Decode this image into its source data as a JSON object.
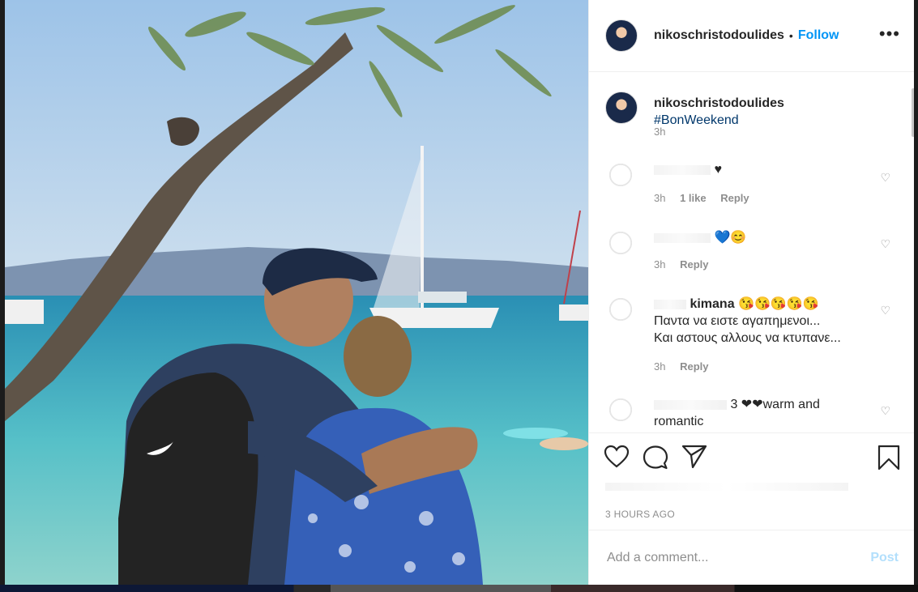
{
  "post": {
    "username": "nikoschristodoulides",
    "dot": "•",
    "follow_label": "Follow",
    "more_label": "•••",
    "caption_tag": "#BonWeekend",
    "caption_time": "3h",
    "timestamp": "3 HOURS AGO"
  },
  "comments": [
    {
      "text": "♥",
      "time": "3h",
      "likes": "1 like",
      "reply": "Reply"
    },
    {
      "text": "💙😊",
      "time": "3h",
      "reply": "Reply"
    },
    {
      "name_visible": "kimana",
      "emoji": "😘😘😘😘😘",
      "line1": "Παντα να ειστε αγαπημενοι...",
      "line2": "Και αστους αλλους να κτυπανε...",
      "time": "3h",
      "reply": "Reply"
    },
    {
      "text": "3 ❤❤warm and",
      "text2": "romantic"
    }
  ],
  "add_comment": {
    "placeholder": "Add a comment...",
    "post_label": "Post"
  },
  "icons": {
    "like": "heart-icon",
    "comment": "comment-icon",
    "share": "paper-plane-icon",
    "save": "bookmark-icon"
  },
  "colors": {
    "follow": "#0095f6",
    "hashtag": "#00376b",
    "post_disabled": "#b2dffc",
    "meta": "#8e8e8e"
  }
}
